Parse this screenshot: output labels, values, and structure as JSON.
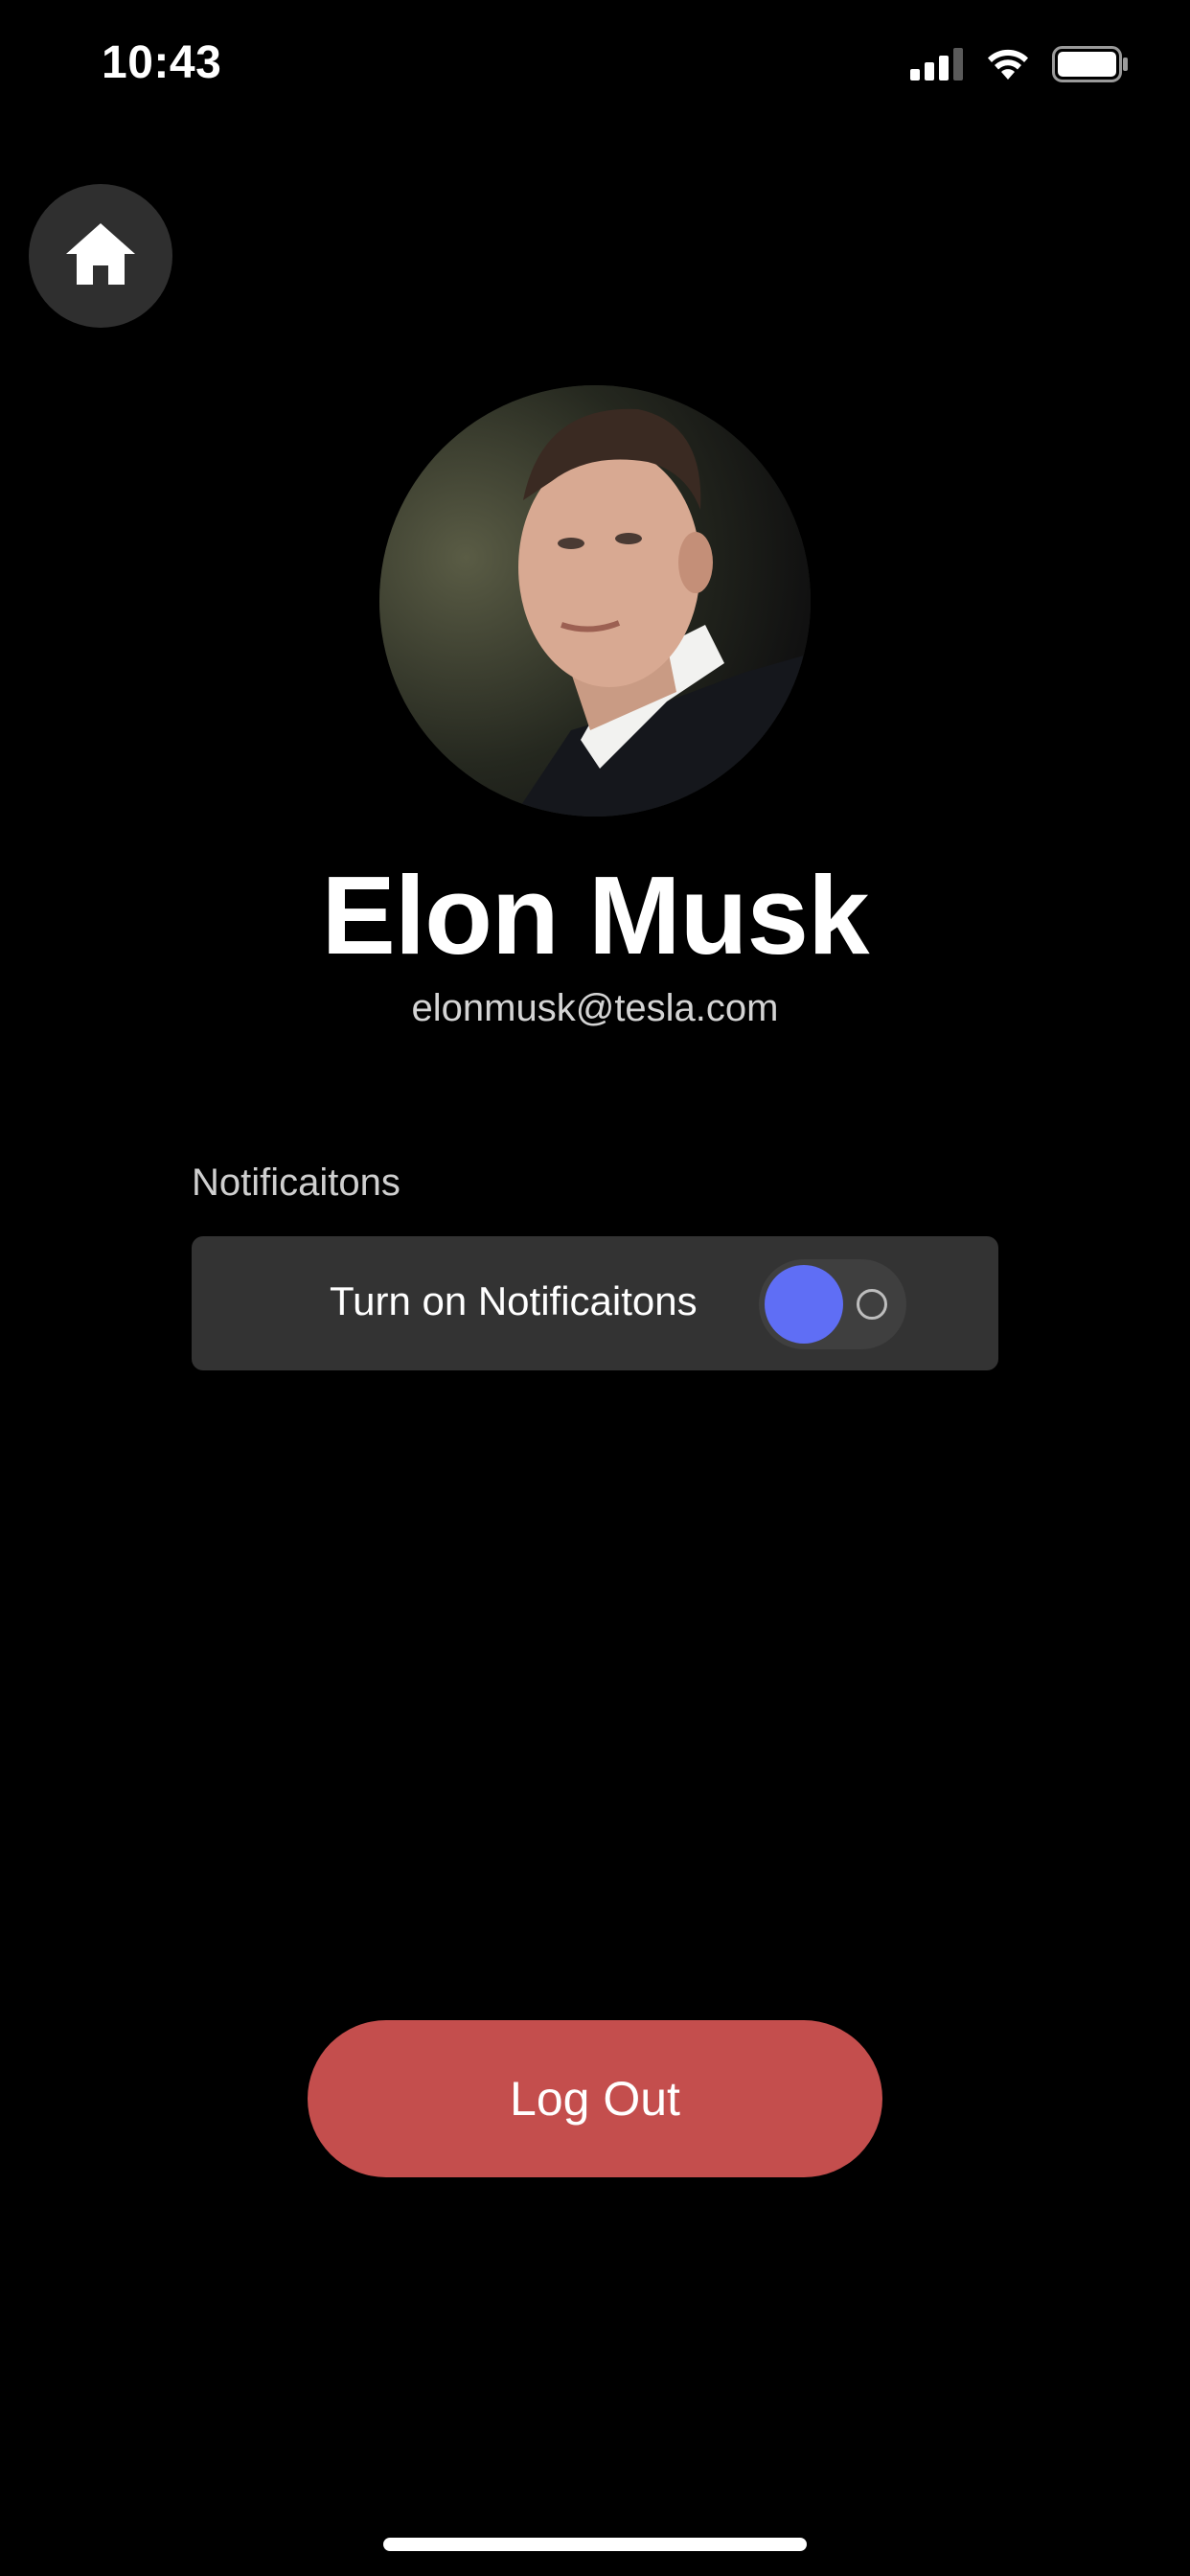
{
  "status_bar": {
    "time": "10:43",
    "signal_icon": "cellular-signal-icon",
    "wifi_icon": "wifi-icon",
    "battery_icon": "battery-icon"
  },
  "nav": {
    "home_icon": "home-icon"
  },
  "profile": {
    "name": "Elon Musk",
    "email": "elonmusk@tesla.com"
  },
  "notifications": {
    "section_label": "Notificaitons",
    "toggle_label": "Turn on Notificaitons",
    "toggle_on": false,
    "accent_color": "#5f6ef5"
  },
  "actions": {
    "logout_label": "Log Out",
    "logout_color": "#c44e4d"
  }
}
